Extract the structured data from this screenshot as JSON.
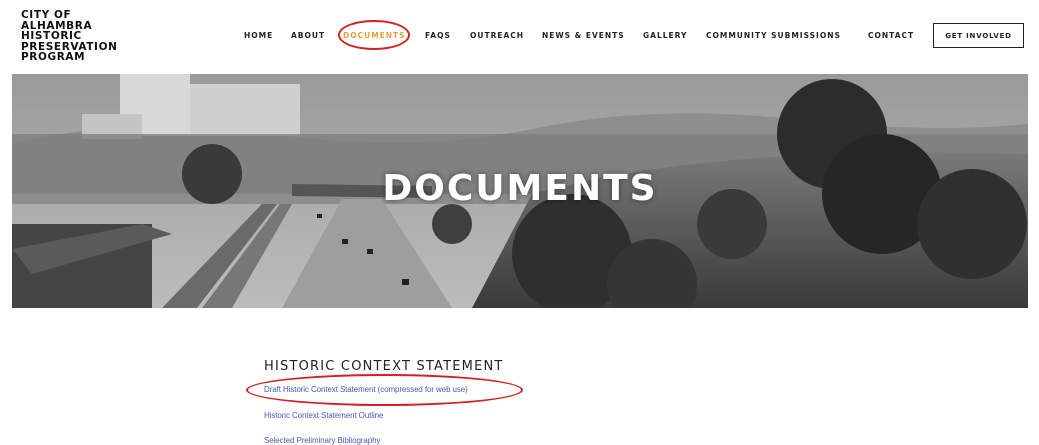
{
  "logo": {
    "lines": [
      "CITY OF",
      "ALHAMBRA",
      "HISTORIC",
      "PRESERVATION",
      "PROGRAM"
    ]
  },
  "nav": {
    "items": [
      {
        "label": "HOME"
      },
      {
        "label": "ABOUT"
      },
      {
        "label": "DOCUMENTS",
        "active": true
      },
      {
        "label": "FAQS"
      },
      {
        "label": "OUTREACH"
      },
      {
        "label": "NEWS & EVENTS"
      },
      {
        "label": "GALLERY"
      },
      {
        "label": "COMMUNITY SUBMISSIONS"
      },
      {
        "label": "CONTACT"
      }
    ],
    "cta_label": "GET INVOLVED"
  },
  "hero": {
    "title": "DOCUMENTS"
  },
  "content": {
    "section_title": "HISTORIC CONTEXT STATEMENT",
    "links": [
      {
        "label": "Draft Historic Context Statement (compressed for web use)"
      },
      {
        "label": "Historic Context Statement Outline"
      },
      {
        "label": "Selected Preliminary Bibliography"
      }
    ]
  },
  "colors": {
    "active_nav": "#e0a43a",
    "annotation_red": "#d42020",
    "link": "#4a5bb5"
  }
}
